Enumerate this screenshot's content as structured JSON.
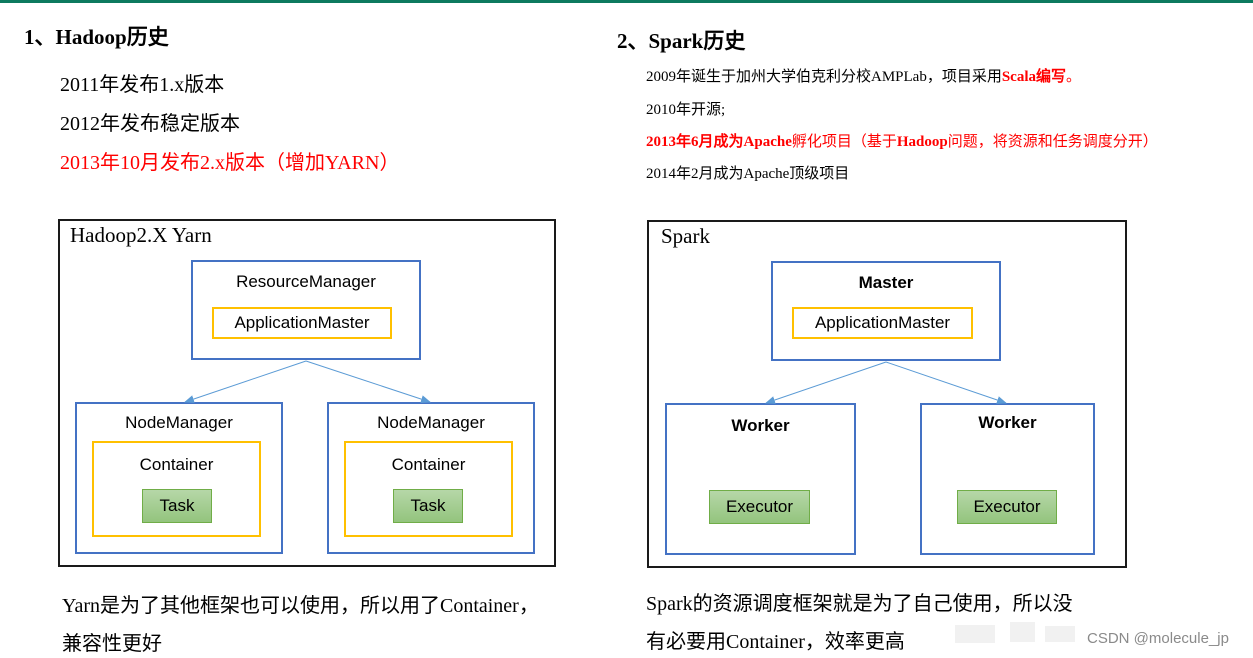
{
  "colors": {
    "top_bar": "#0d7a5f",
    "highlight_red": "#ff0000",
    "box_blue": "#4472c4",
    "box_yellow": "#ffc000",
    "box_green": "#93c47d",
    "arrow_blue": "#5b9bd5"
  },
  "hadoop": {
    "heading": "1、Hadoop历史",
    "history": [
      {
        "text": "2011年发布1.x版本",
        "highlight": false
      },
      {
        "text": "2012年发布稳定版本",
        "highlight": false
      },
      {
        "text": "2013年10月发布2.x版本（增加YARN）",
        "highlight": true
      }
    ],
    "diagram": {
      "title": "Hadoop2.X Yarn",
      "top": {
        "label": "ResourceManager",
        "inner": "ApplicationMaster"
      },
      "nodes": [
        {
          "label": "NodeManager",
          "container": "Container",
          "task": "Task"
        },
        {
          "label": "NodeManager",
          "container": "Container",
          "task": "Task"
        }
      ]
    },
    "note_lines": [
      "Yarn是为了其他框架也可以使用，所以用了Container，",
      "兼容性更好"
    ]
  },
  "spark": {
    "heading": "2、Spark历史",
    "history": {
      "line1": {
        "a": "2009年诞生于加州大学伯克利分校AMPLab，项目采用",
        "b": "Scala编写",
        "c": "。"
      },
      "line2": "2010年开源;",
      "line3": {
        "a": "2013年6月成为",
        "b": "Apache",
        "c": "孵化项目（基于",
        "d": "Hadoop",
        "e": "问题，将资源和任务调度分开）"
      },
      "line4": "2014年2月成为Apache顶级项目"
    },
    "diagram": {
      "title": "Spark",
      "top": {
        "label": "Master",
        "inner": "ApplicationMaster"
      },
      "nodes": [
        {
          "label": "Worker",
          "executor": "Executor"
        },
        {
          "label": "Worker",
          "executor": "Executor"
        }
      ]
    },
    "note_lines": [
      "Spark的资源调度框架就是为了自己使用，所以没",
      "有必要用Container，效率更高"
    ]
  },
  "watermark": "CSDN @molecule_jp"
}
